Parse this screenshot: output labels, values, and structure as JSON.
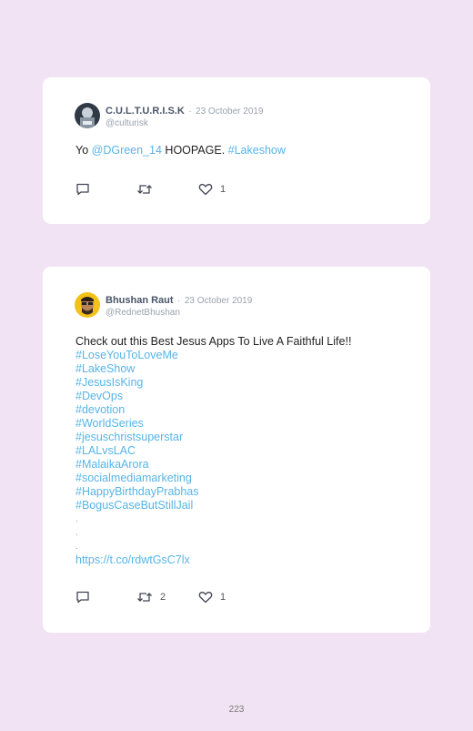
{
  "tweets": [
    {
      "author_name": "C.U.L.T.U.R.I.S.K",
      "separator": "·",
      "date": "23 October 2019",
      "handle": "@culturisk",
      "text_parts": [
        {
          "text": "Yo ",
          "link": false
        },
        {
          "text": "@DGreen_14",
          "link": true
        },
        {
          "text": " HOOPAGE. ",
          "link": false
        },
        {
          "text": "#Lakeshow",
          "link": true
        }
      ],
      "reply_count": "",
      "retweet_count": "",
      "like_count": "1"
    },
    {
      "author_name": "Bhushan Raut",
      "separator": "·",
      "date": "23 October 2019",
      "handle": "@RednetBhushan",
      "lines": [
        "Check out this Best Jesus Apps To Live A Faithful Life!!",
        "#LoseYouToLoveMe",
        "#LakeShow",
        "#JesusIsKing",
        "#DevOps",
        "#devotion",
        "#WorldSeries",
        "#jesuschristsuperstar",
        "#LALvsLAC",
        "#MalaikaArora",
        "#socialmediamarketing",
        "#HappyBirthdayPrabhas",
        "#BogusCaseButStillJail",
        ".",
        ".",
        ".",
        "https://t.co/rdwtGsC7lx"
      ],
      "reply_count": "",
      "retweet_count": "2",
      "like_count": "1"
    }
  ],
  "page_number": "223",
  "colors": {
    "background": "#f1e3f4",
    "card": "#ffffff",
    "link": "#57b4e6"
  },
  "icons": {
    "reply": "speech-bubble-icon",
    "retweet": "retweet-icon",
    "like": "heart-icon"
  }
}
